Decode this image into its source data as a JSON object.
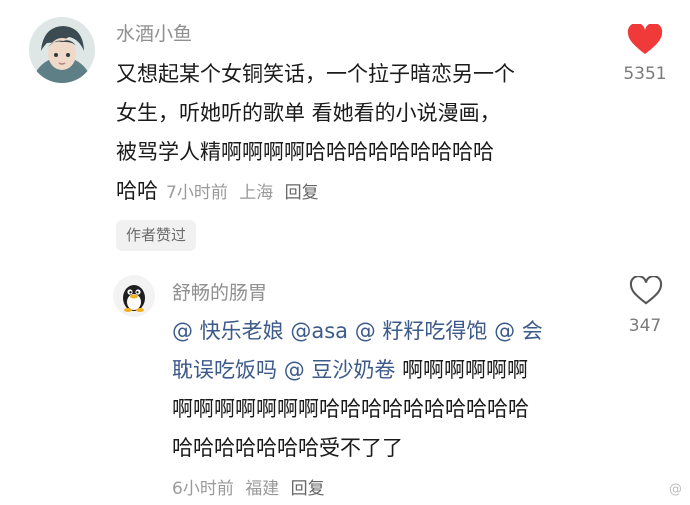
{
  "comment": {
    "username": "水酒小鱼",
    "lines": [
      "又想起某个女铜笑话，一个拉子暗恋另一个",
      "女生，听她听的歌单 看她看的小说漫画，",
      "被骂学人精啊啊啊啊哈哈哈哈哈哈哈哈哈"
    ],
    "last_line": "哈哈",
    "time": "7小时前",
    "location": "上海",
    "reply_label": "回复",
    "like_count": "5351",
    "liked": true,
    "author_badge": "作者赞过"
  },
  "reply": {
    "username": "舒畅的肠胃",
    "mentions_line1": [
      "@ 快乐老娘",
      "@asa",
      "@ 籽籽吃得饱",
      "@ 会"
    ],
    "line2_mention_a": "耽误吃饭吗",
    "line2_mention_b": "@ 豆沙奶卷",
    "line2_text": "啊啊啊啊啊啊",
    "line3": "啊啊啊啊啊啊啊哈哈哈哈哈哈哈哈哈哈",
    "line4": "哈哈哈哈哈哈哈受不了了",
    "time": "6小时前",
    "location": "福建",
    "reply_label": "回复",
    "like_count": "347",
    "liked": false
  },
  "watermark": "@",
  "colors": {
    "heart_red": "#f03a3a",
    "mention_blue": "#3c5a8a"
  }
}
